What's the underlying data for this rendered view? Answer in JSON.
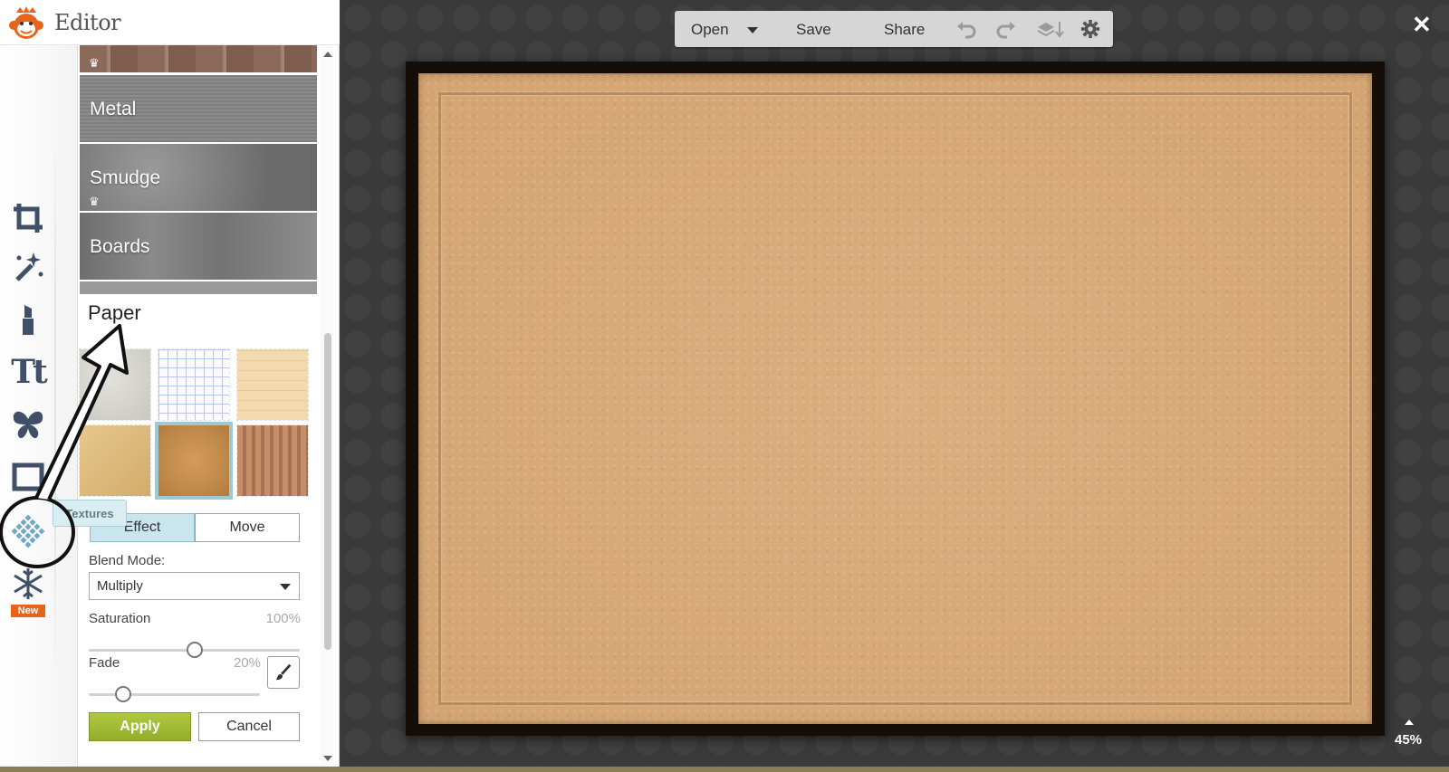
{
  "app": {
    "title": "Editor"
  },
  "panel": {
    "categories": [
      {
        "label": "Metal"
      },
      {
        "label": "Smudge"
      },
      {
        "label": "Boards"
      }
    ],
    "section_title": "Paper",
    "tooltip": "Textures",
    "tabs": {
      "effect": "Effect",
      "move": "Move"
    },
    "blend_mode": {
      "label": "Blend Mode:",
      "value": "Multiply"
    },
    "saturation": {
      "label": "Saturation",
      "value": "100%",
      "level": 1.0
    },
    "fade": {
      "label": "Fade",
      "value": "20%",
      "level": 0.2
    },
    "apply_label": "Apply",
    "cancel_label": "Cancel"
  },
  "rail": {
    "tools": [
      "crop-icon",
      "magic-wand-icon",
      "lipstick-icon",
      "text-icon",
      "butterfly-icon",
      "frame-icon",
      "textures-icon",
      "snowflake-icon"
    ],
    "text_tool_label": "Tt",
    "new_badge": "New"
  },
  "toolbar": {
    "open_label": "Open",
    "save_label": "Save",
    "share_label": "Share"
  },
  "window": {
    "close_label": "✕"
  },
  "zoom": {
    "level": "45%"
  },
  "colors": {
    "apply_green": "#a2bb34",
    "active_tab": "#c9e6ef",
    "new_badge": "#e8641b",
    "icon_blue": "#3f5068"
  }
}
